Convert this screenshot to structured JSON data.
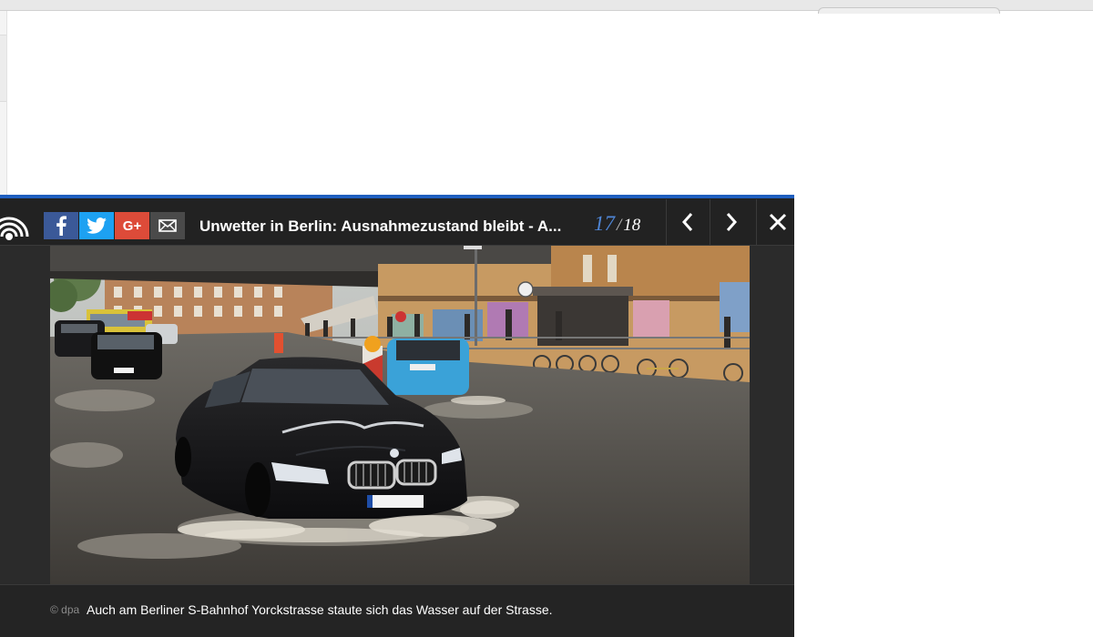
{
  "colors": {
    "accent": "#1f5fbf",
    "counter_current": "#4f86d6",
    "facebook": "#3b5998",
    "twitter": "#1da1f2",
    "googleplus": "#dd4b39"
  },
  "gallery": {
    "title": "Unwetter in Berlin: Ausnahmezustand bleibt - A...",
    "counter": {
      "current": "17",
      "separator": "/",
      "total": "18"
    },
    "share": {
      "googleplus_label": "G+"
    },
    "caption": {
      "credit": "© dpa",
      "text": "Auch am Berliner S-Bahnhof Yorckstrasse staute sich das Wasser auf der Strasse."
    }
  },
  "icons": {
    "logo": "radio-signal-icon",
    "facebook": "facebook-icon",
    "twitter": "twitter-icon",
    "googleplus": "googleplus-icon",
    "mail": "mail-icon",
    "prev": "chevron-left-icon",
    "next": "chevron-right-icon",
    "close": "close-icon"
  }
}
